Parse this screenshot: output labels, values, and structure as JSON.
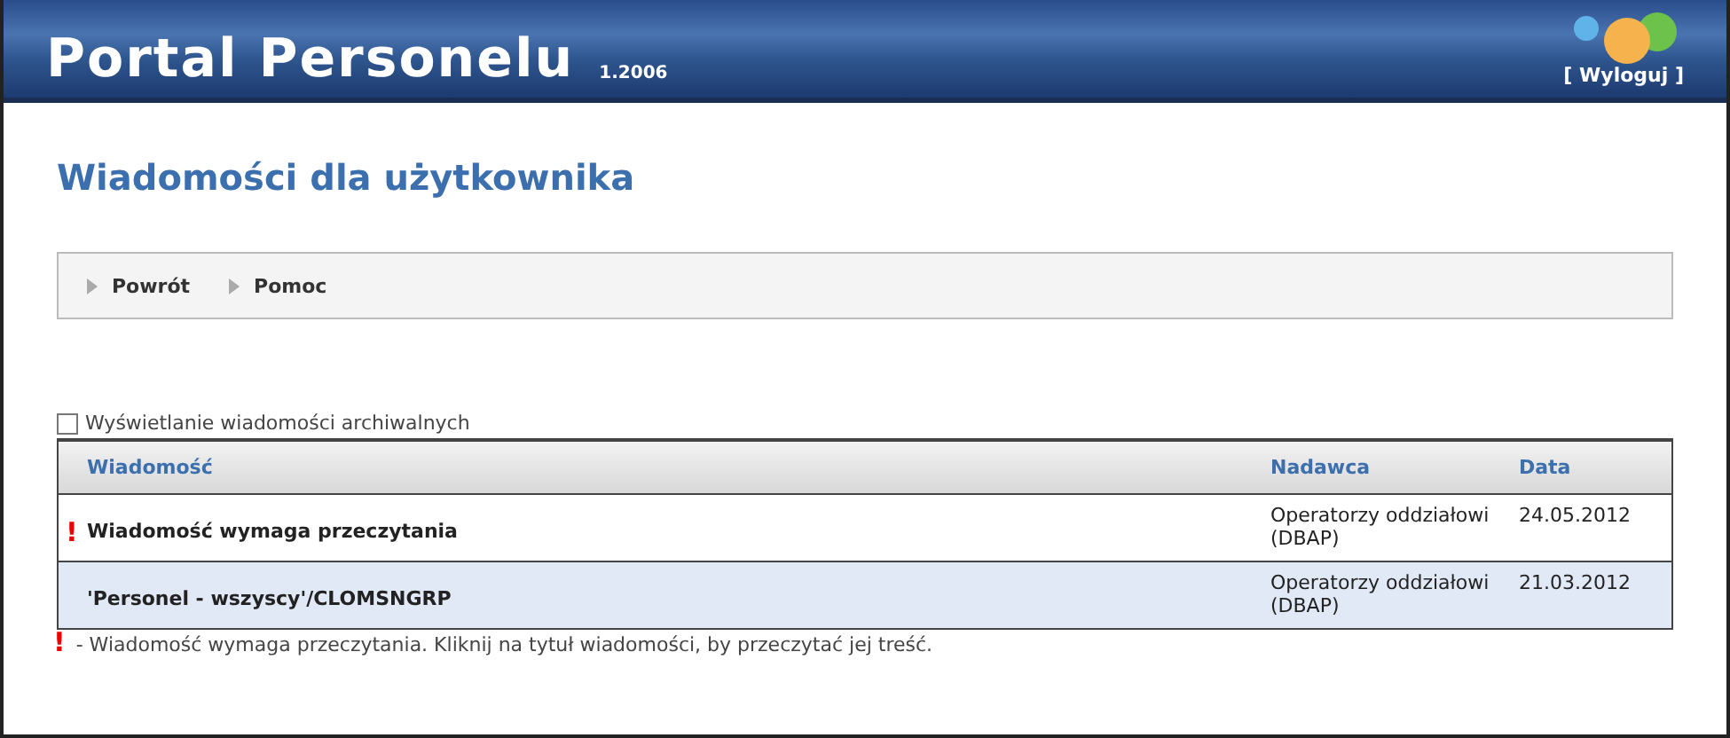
{
  "header": {
    "title": "Portal Personelu",
    "version": "1.2006",
    "logout": "[ Wyloguj ]"
  },
  "page_title": "Wiadomości dla użytkownika",
  "toolbar": [
    {
      "label": "Powrót"
    },
    {
      "label": "Pomoc"
    }
  ],
  "archive_option": {
    "label": "Wyświetlanie wiadomości archiwalnych",
    "checked": false
  },
  "table": {
    "columns": [
      "Wiadomość",
      "Nadawca",
      "Data"
    ],
    "rows": [
      {
        "unread_mark": "!",
        "selected": false,
        "message": "Wiadomość wymaga przeczytania",
        "sender": "Operatorzy oddziałowi (DBAP)",
        "date": "24.05.2012"
      },
      {
        "selected": true,
        "message": "'Personel - wszyscy'/CLOMSNGRP",
        "sender": "Operatorzy oddziałowi (DBAP)",
        "date": "21.03.2012"
      }
    ]
  },
  "legend": {
    "mark": "!",
    "text": "- Wiadomość wymaga przeczytania. Kliknij na tytuł wiadomości, by przeczytać jej treść."
  }
}
